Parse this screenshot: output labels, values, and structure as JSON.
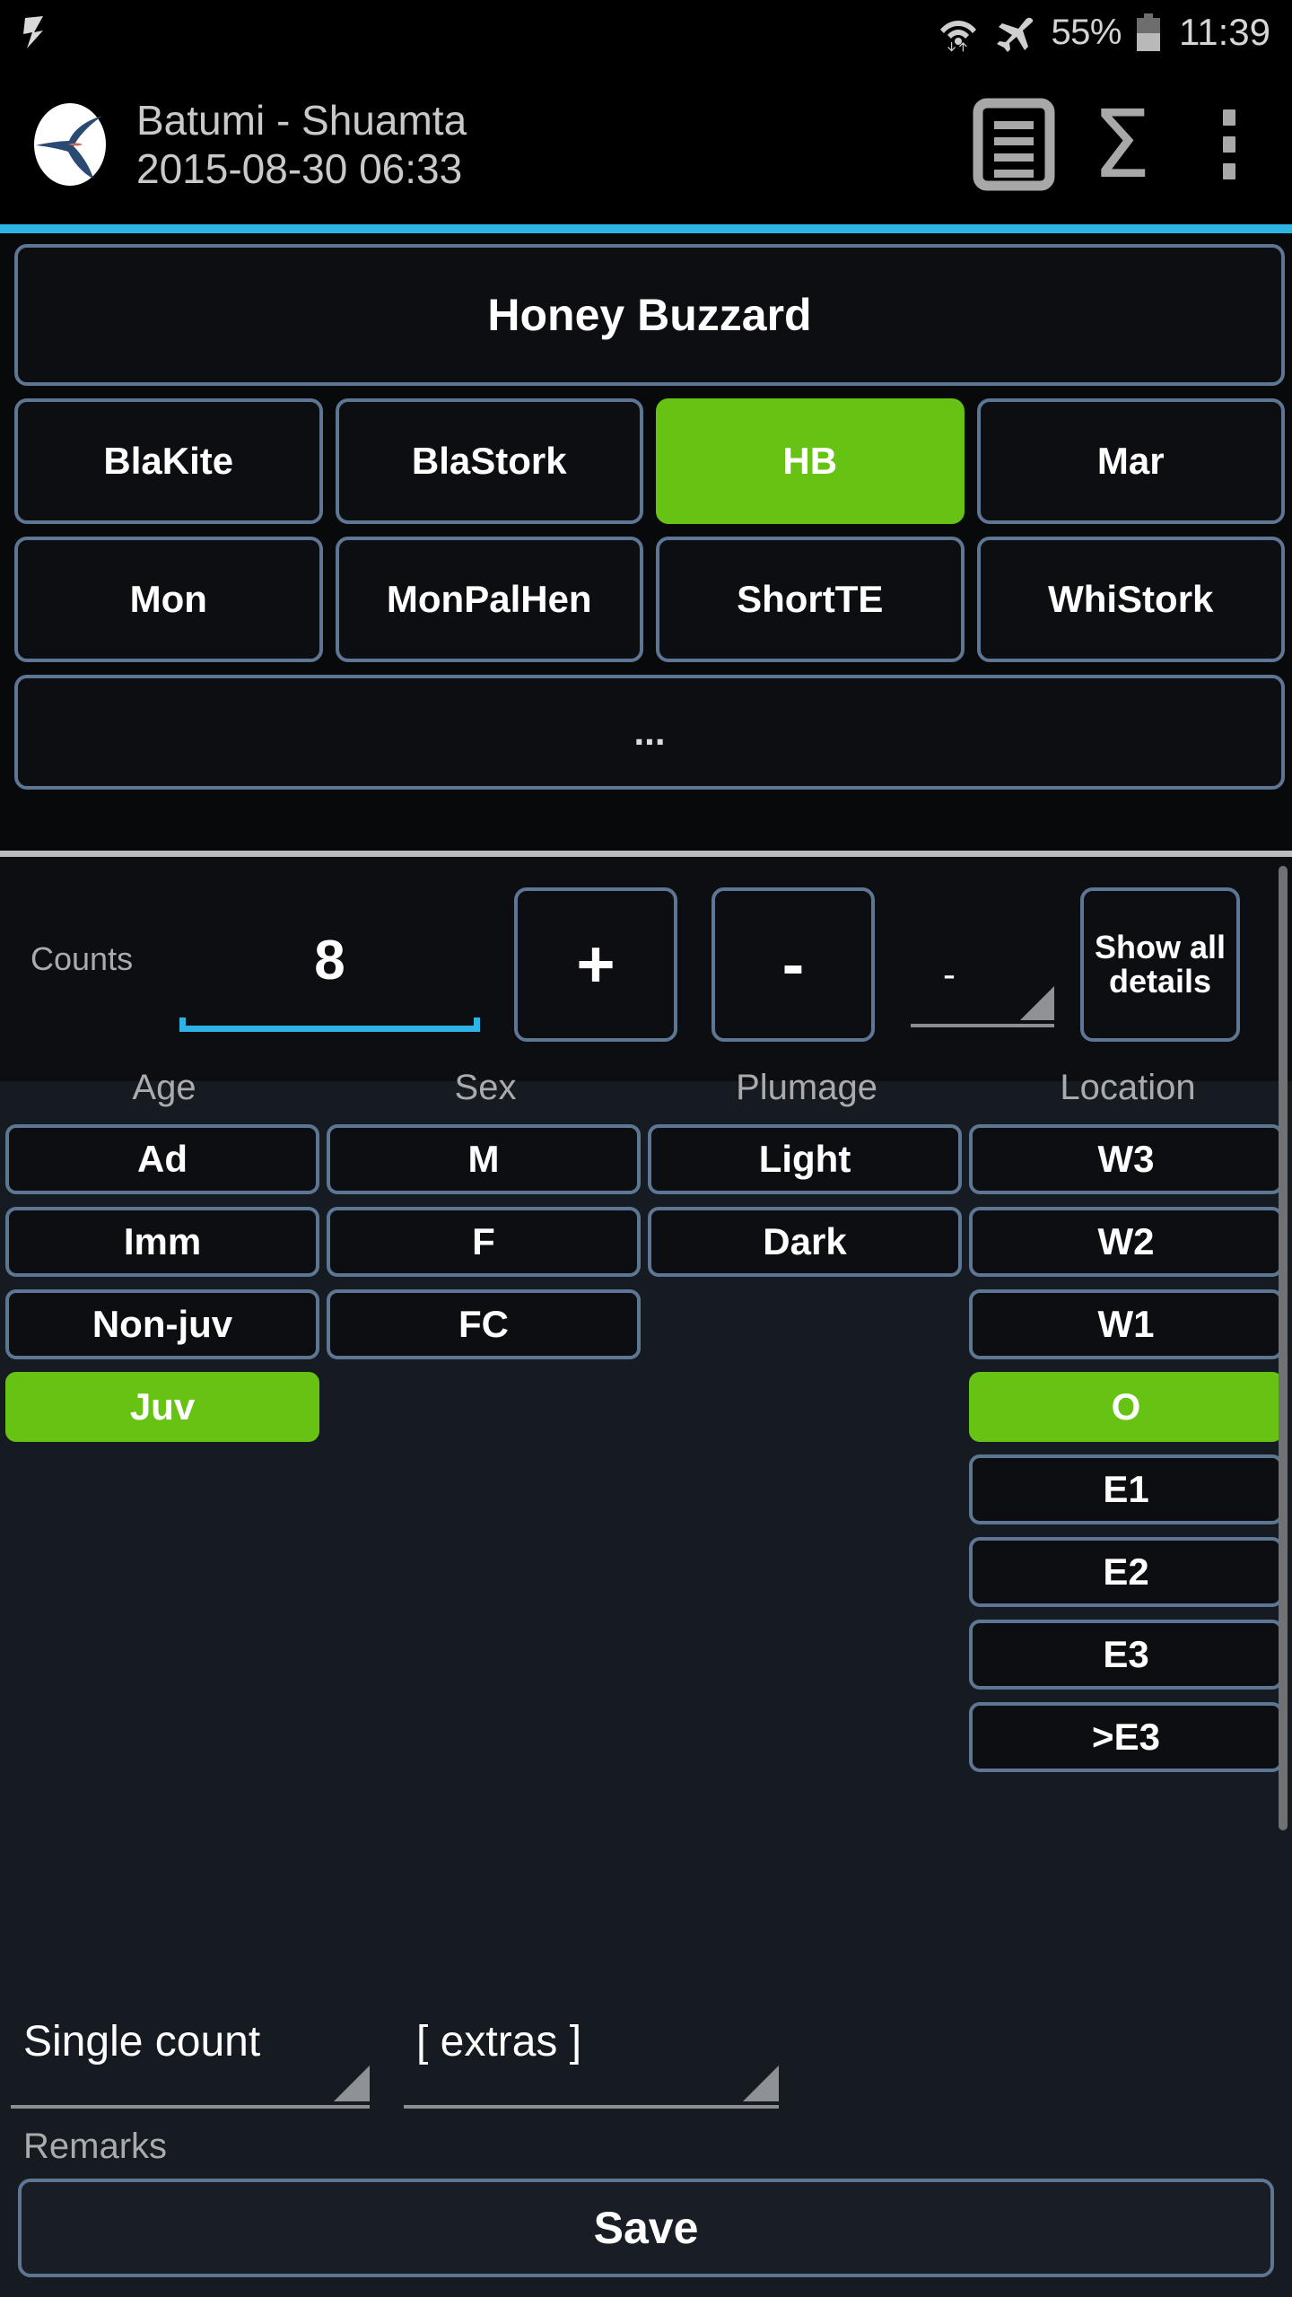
{
  "statusbar": {
    "app_icon": "app-notification-icon",
    "wifi_icon": "wifi-icon",
    "airplane_icon": "airplane-mode-icon",
    "battery_percent": "55%",
    "battery_icon": "battery-icon",
    "time": "11:39"
  },
  "titlebar": {
    "logo_icon": "raptor-logo-icon",
    "site": "Batumi - Shuamta",
    "datetime": "2015-08-30 06:33",
    "list_icon": "list-icon",
    "sum_icon": "sigma-sum-icon",
    "overflow_icon": "overflow-menu-icon"
  },
  "species": {
    "current": "Honey Buzzard",
    "shortcuts": [
      "BlaKite",
      "BlaStork",
      "HB",
      "Mar",
      "Mon",
      "MonPalHen",
      "ShortTE",
      "WhiStork"
    ],
    "selected_shortcut": "HB",
    "more_label": "..."
  },
  "count": {
    "label": "Counts",
    "value": "8",
    "plus_label": "+",
    "minus_label": "-",
    "extra_spinner_value": "-",
    "show_all_details_line1": "Show all",
    "show_all_details_line2": "details"
  },
  "attributes": {
    "columns": [
      {
        "header": "Age",
        "options": [
          "Ad",
          "Imm",
          "Non-juv",
          "Juv"
        ],
        "selected": "Juv"
      },
      {
        "header": "Sex",
        "options": [
          "M",
          "F",
          "FC"
        ],
        "selected": null
      },
      {
        "header": "Plumage",
        "options": [
          "Light",
          "Dark"
        ],
        "selected": null
      },
      {
        "header": "Location",
        "options": [
          "W3",
          "W2",
          "W1",
          "O",
          "E1",
          "E2",
          "E3",
          ">E3"
        ],
        "selected": "O"
      }
    ]
  },
  "bottom": {
    "count_type": "Single count",
    "extras": "[ extras ]",
    "remarks_label": "Remarks",
    "save_label": "Save"
  },
  "colors": {
    "accent": "#2fb3e4",
    "selected_green": "#67c313",
    "button_border": "#5c7693",
    "button_bg": "#0c0e11",
    "panel_bg": "#161a21",
    "text": "#ffffff",
    "muted_text": "#a9abad"
  }
}
